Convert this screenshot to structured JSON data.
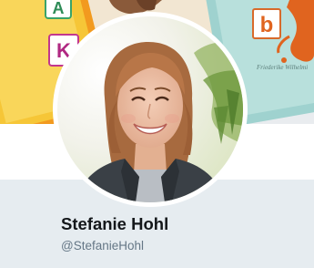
{
  "profile": {
    "display_name": "Stefanie Hohl",
    "screen_name": "@StefanieHohl"
  },
  "banner": {
    "book_left": {
      "letters": [
        "A",
        "K"
      ]
    },
    "book_right": {
      "letter": "b",
      "author": "Friederike Wilhelmi"
    }
  },
  "colors": {
    "name_text": "#14171a",
    "handle_text": "#657786",
    "page_background": "#e6ecf0",
    "avatar_border": "#ffffff"
  }
}
